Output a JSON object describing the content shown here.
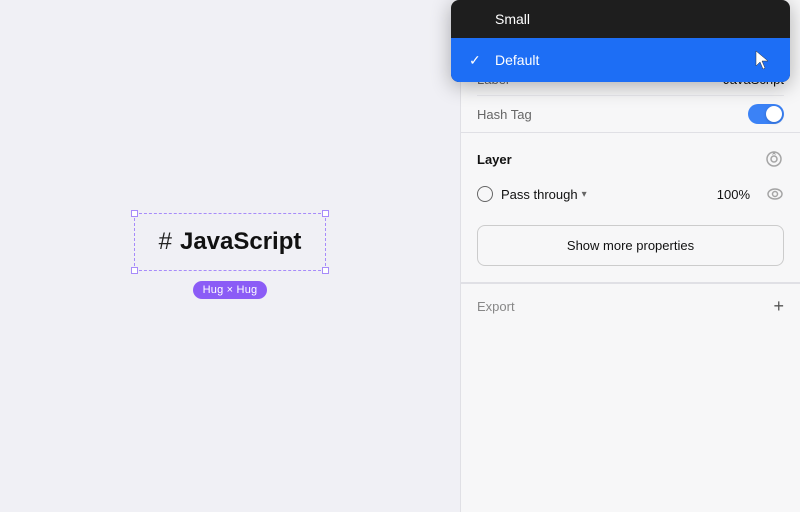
{
  "canvas": {
    "component": {
      "hash_symbol": "#",
      "label": "JavaScript",
      "hug_badge": "Hug × Hug"
    }
  },
  "dropdown": {
    "items": [
      {
        "id": "small",
        "label": "Small",
        "selected": false
      },
      {
        "id": "default",
        "label": "Default",
        "selected": true
      }
    ]
  },
  "panel": {
    "three_dots_label": "⋯",
    "properties": {
      "label_key": "Label",
      "label_value": "JavaScript",
      "hash_tag_key": "Hash Tag",
      "hash_tag_enabled": true
    },
    "layer": {
      "title": "Layer",
      "blend_mode": "Pass through",
      "opacity": "100%"
    },
    "show_more_button": "Show more properties",
    "export": {
      "label": "Export",
      "plus": "+"
    }
  }
}
